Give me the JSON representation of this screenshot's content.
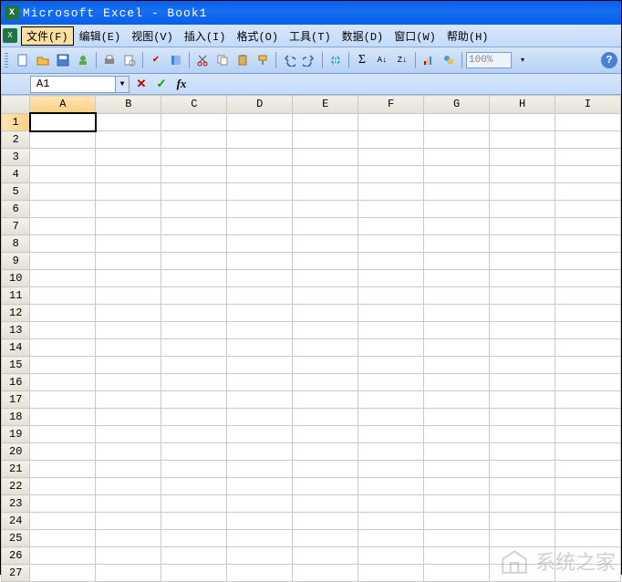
{
  "title": "Microsoft Excel - Book1",
  "menu": {
    "file": "文件(F)",
    "edit": "编辑(E)",
    "view": "视图(V)",
    "insert": "插入(I)",
    "format": "格式(O)",
    "tools": "工具(T)",
    "data": "数据(D)",
    "window": "窗口(W)",
    "help": "帮助(H)"
  },
  "toolbar": {
    "zoom": "100%"
  },
  "namebox": {
    "value": "A1"
  },
  "formula_btns": {
    "cancel": "✕",
    "enter": "✓",
    "fx": "fx"
  },
  "columns": [
    "A",
    "B",
    "C",
    "D",
    "E",
    "F",
    "G",
    "H",
    "I"
  ],
  "rows": [
    "1",
    "2",
    "3",
    "4",
    "5",
    "6",
    "7",
    "8",
    "9",
    "10",
    "11",
    "12",
    "13",
    "14",
    "15",
    "16",
    "17",
    "18",
    "19",
    "20",
    "21",
    "22",
    "23",
    "24",
    "25",
    "26",
    "27"
  ],
  "active_cell": {
    "row": 0,
    "col": 0
  },
  "watermark": "系统之家"
}
